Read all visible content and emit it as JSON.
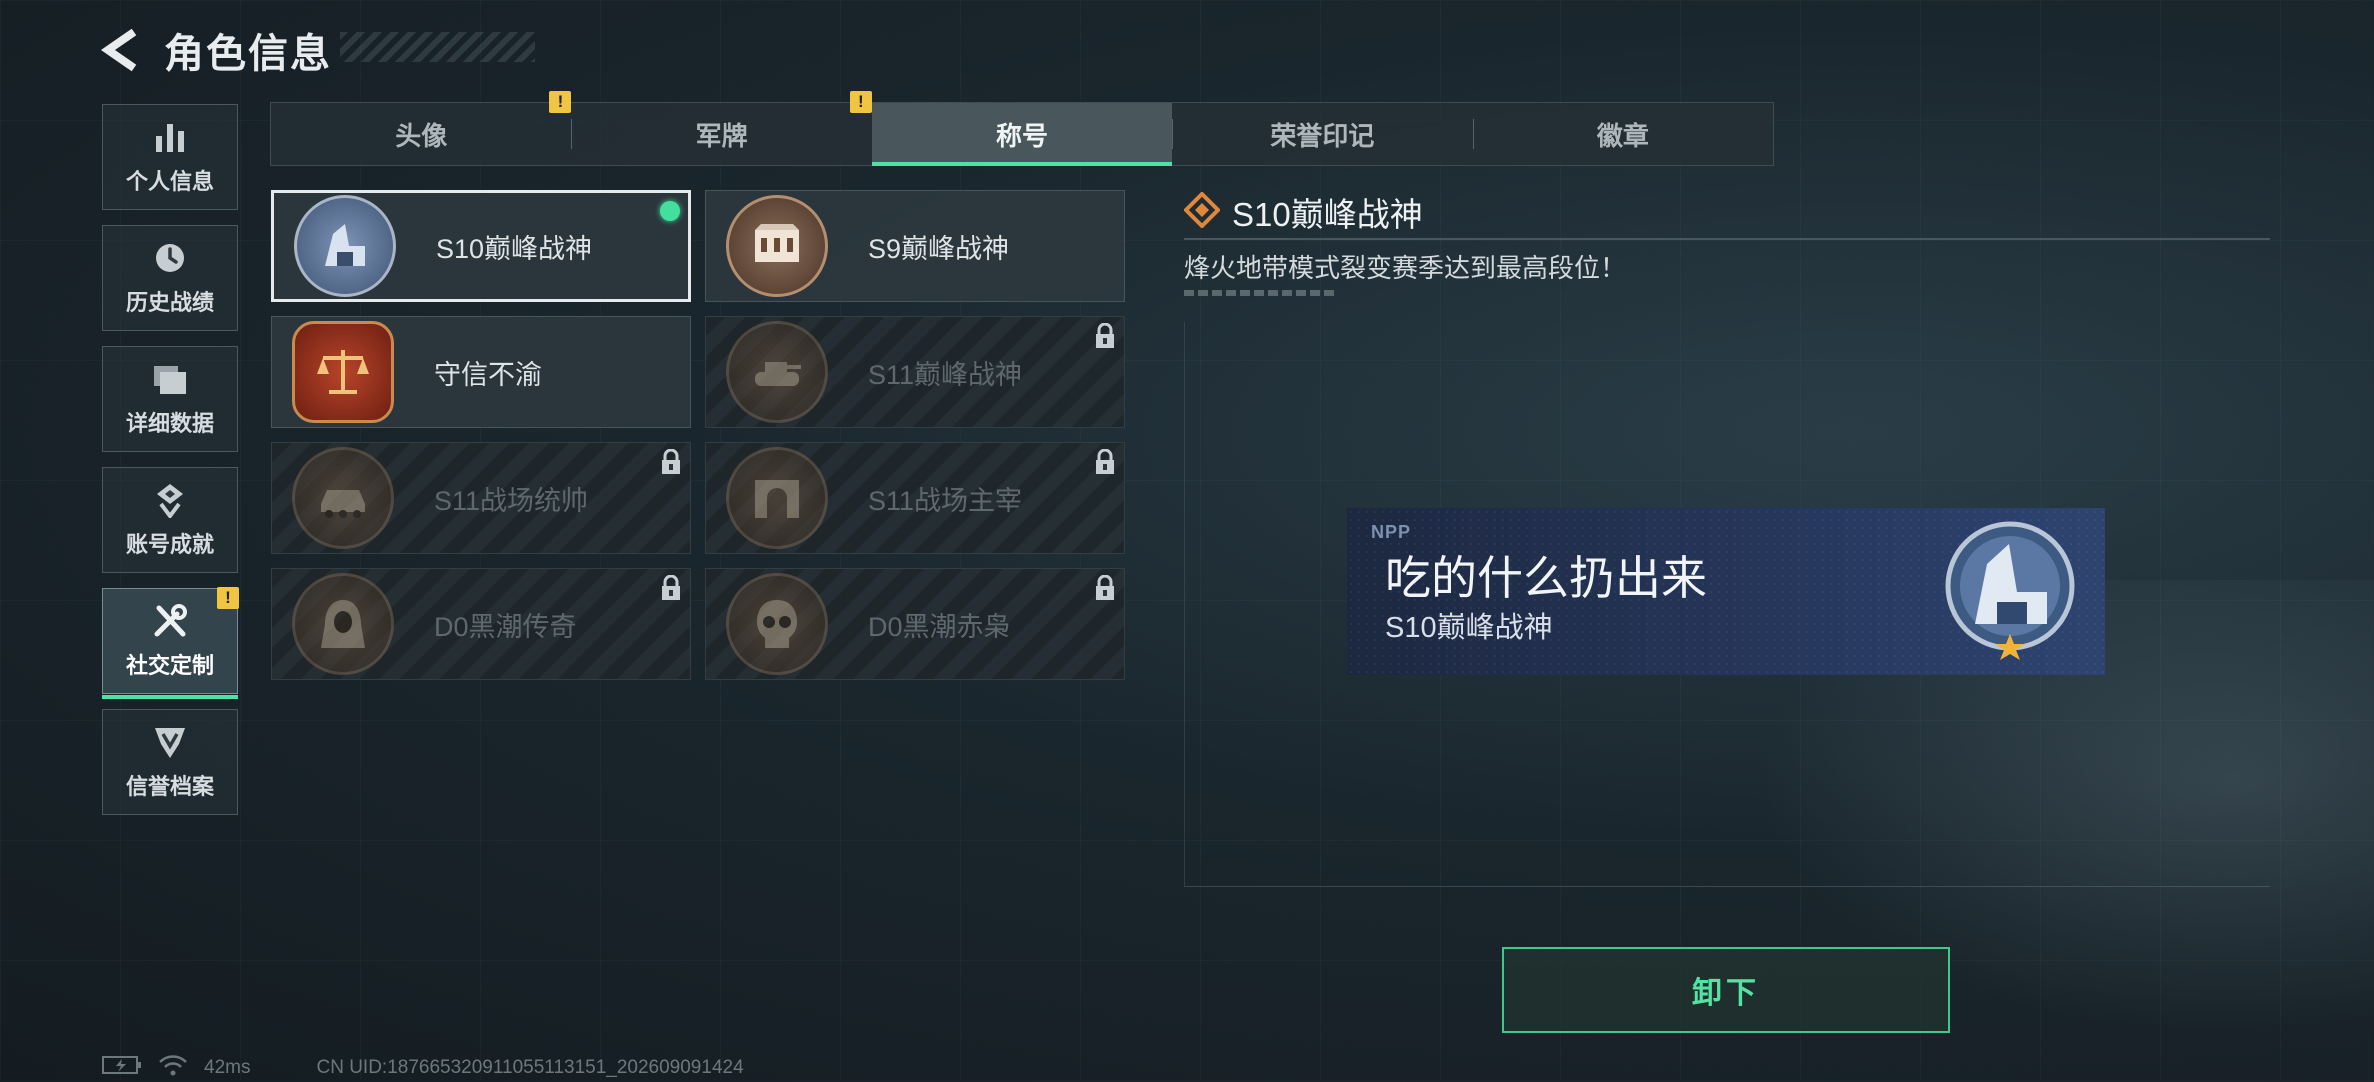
{
  "header": {
    "title": "角色信息"
  },
  "sidebar": {
    "items": [
      {
        "label": "个人信息",
        "icon": "bar-chart-icon",
        "active": false,
        "warn": false
      },
      {
        "label": "历史战绩",
        "icon": "history-icon",
        "active": false,
        "warn": false
      },
      {
        "label": "详细数据",
        "icon": "folder-icon",
        "active": false,
        "warn": false
      },
      {
        "label": "账号成就",
        "icon": "achievement-icon",
        "active": false,
        "warn": false
      },
      {
        "label": "社交定制",
        "icon": "tools-icon",
        "active": true,
        "warn": true
      },
      {
        "label": "信誉档案",
        "icon": "shield-badge-icon",
        "active": false,
        "warn": false
      }
    ]
  },
  "tabs": [
    {
      "label": "头像",
      "active": false,
      "warn": true
    },
    {
      "label": "军牌",
      "active": false,
      "warn": true
    },
    {
      "label": "称号",
      "active": true,
      "warn": false
    },
    {
      "label": "荣誉印记",
      "active": false,
      "warn": false
    },
    {
      "label": "徽章",
      "active": false,
      "warn": false
    }
  ],
  "warn_symbol": "!",
  "titles": [
    {
      "name": "S10巅峰战神",
      "selected": true,
      "equipped": true,
      "locked": false,
      "medal": "silver-fortress-medal"
    },
    {
      "name": "S9巅峰战神",
      "selected": false,
      "equipped": false,
      "locked": false,
      "medal": "bronze-fortress-medal"
    },
    {
      "name": "守信不渝",
      "selected": false,
      "equipped": false,
      "locked": false,
      "medal": "scales-medal"
    },
    {
      "name": "S11巅峰战神",
      "selected": false,
      "equipped": false,
      "locked": true,
      "medal": "tank-medal"
    },
    {
      "name": "S11战场统帅",
      "selected": false,
      "equipped": false,
      "locked": true,
      "medal": "apc-medal"
    },
    {
      "name": "S11战场主宰",
      "selected": false,
      "equipped": false,
      "locked": true,
      "medal": "arch-medal"
    },
    {
      "name": "D0黑潮传奇",
      "selected": false,
      "equipped": false,
      "locked": true,
      "medal": "hooded-figure-medal"
    },
    {
      "name": "D0黑潮赤枭",
      "selected": false,
      "equipped": false,
      "locked": true,
      "medal": "skull-medal"
    }
  ],
  "detail": {
    "title": "S10巅峰战神",
    "description": "烽火地带模式裂变赛季达到最高段位！"
  },
  "preview": {
    "tag": "NPP",
    "player_name": "吃的什么扔出来",
    "title": "S10巅峰战神"
  },
  "action": {
    "unequip_label": "卸下"
  },
  "status": {
    "ping": "42ms",
    "uid": "CN UID:187665320911055113151_202609091424"
  },
  "colors": {
    "accent_green": "#4fe2a4",
    "warn_yellow": "#f0c542",
    "banner_blue": "#26365a"
  }
}
